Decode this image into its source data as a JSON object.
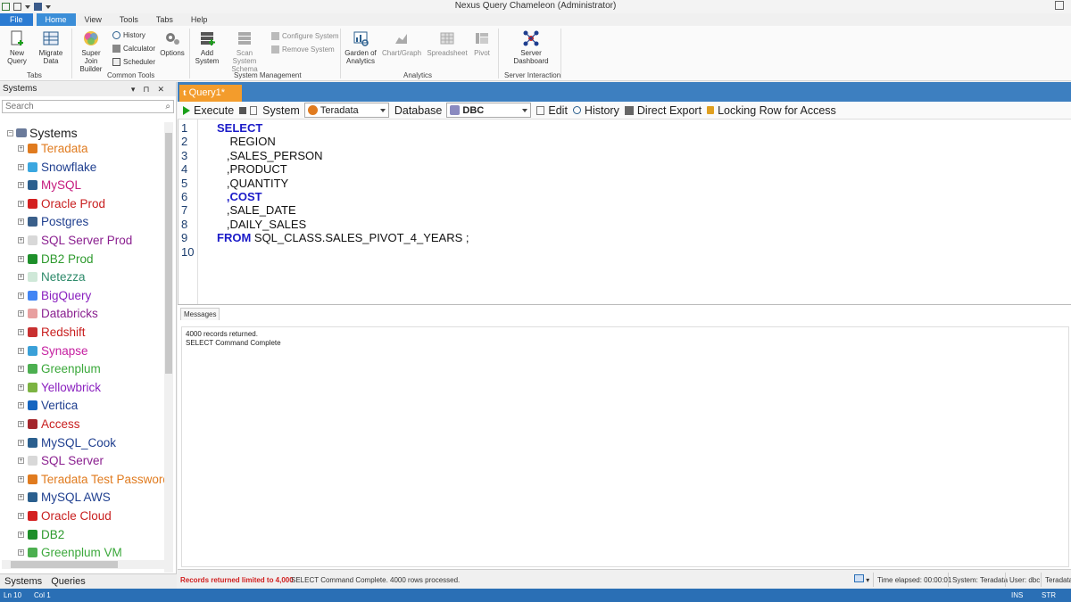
{
  "window": {
    "title": "Nexus Query Chameleon (Administrator)"
  },
  "menu": [
    "File",
    "Home",
    "View",
    "Tools",
    "Tabs",
    "Help"
  ],
  "ribbon": {
    "tabs_group": {
      "label": "Tabs",
      "new_query": "New Query",
      "migrate_data": "Migrate Data"
    },
    "common_tools": {
      "label": "Common Tools",
      "super_join": "Super Join Builder",
      "history": "History",
      "calculator": "Calculator",
      "scheduler": "Scheduler",
      "options": "Options"
    },
    "system_mgmt": {
      "label": "System Management",
      "add_system": "Add System",
      "scan_system": "Scan System Schema",
      "configure_system": "Configure System",
      "remove_system": "Remove System"
    },
    "analytics": {
      "label": "Analytics",
      "garden": "Garden of Analytics",
      "chart_graph": "Chart/Graph",
      "spreadsheet": "Spreadsheet",
      "pivot": "Pivot"
    },
    "server": {
      "label": "Server Interaction",
      "dashboard": "Server Dashboard"
    }
  },
  "systems_panel": {
    "title": "Systems",
    "search_placeholder": "Search",
    "root": "Systems",
    "items": [
      {
        "label": "Teradata",
        "color": "#e07b1f",
        "icon": "#e07b1f"
      },
      {
        "label": "Snowflake",
        "color": "#1f3f8f",
        "icon": "#3ba7e0"
      },
      {
        "label": "MySQL",
        "color": "#c5197d",
        "icon": "#2b5f8e"
      },
      {
        "label": "Oracle Prod",
        "color": "#c81e1e",
        "icon": "#d42020"
      },
      {
        "label": "Postgres",
        "color": "#1f3f8f",
        "icon": "#3a5f8a"
      },
      {
        "label": "SQL Server Prod",
        "color": "#8a1f8f",
        "icon": "#d8d8d8"
      },
      {
        "label": "DB2 Prod",
        "color": "#2d9a2d",
        "icon": "#1e8f2a"
      },
      {
        "label": "Netezza",
        "color": "#2d8a6a",
        "icon": "#cfe8d8"
      },
      {
        "label": "BigQuery",
        "color": "#8a1fbf",
        "icon": "#4285f4"
      },
      {
        "label": "Databricks",
        "color": "#8a1f8f",
        "icon": "#e8a0a0"
      },
      {
        "label": "Redshift",
        "color": "#c81e1e",
        "icon": "#c83030"
      },
      {
        "label": "Synapse",
        "color": "#c51fa0",
        "icon": "#3aa0d8"
      },
      {
        "label": "Greenplum",
        "color": "#3aa83a",
        "icon": "#4caf50"
      },
      {
        "label": "Yellowbrick",
        "color": "#8a1fbf",
        "icon": "#7cb342"
      },
      {
        "label": "Vertica",
        "color": "#1f3f8f",
        "icon": "#1565c0"
      },
      {
        "label": "Access",
        "color": "#c81e1e",
        "icon": "#a4262c"
      },
      {
        "label": "MySQL_Cook",
        "color": "#1f3f8f",
        "icon": "#2b5f8e"
      },
      {
        "label": "SQL Server",
        "color": "#8a1f8f",
        "icon": "#d8d8d8"
      },
      {
        "label": "Teradata Test Password",
        "color": "#e07b1f",
        "icon": "#e07b1f"
      },
      {
        "label": "MySQL AWS",
        "color": "#1f3f8f",
        "icon": "#2b5f8e"
      },
      {
        "label": "Oracle Cloud",
        "color": "#c81e1e",
        "icon": "#d42020"
      },
      {
        "label": "DB2",
        "color": "#2d9a2d",
        "icon": "#1e8f2a"
      },
      {
        "label": "Greenplum VM",
        "color": "#3aa83a",
        "icon": "#4caf50"
      }
    ],
    "tabs": [
      "Systems",
      "Queries"
    ]
  },
  "query_tab": {
    "label": "Query1*"
  },
  "toolbar": {
    "execute": "Execute",
    "system_label": "System",
    "system_value": "Teradata",
    "database_label": "Database",
    "database_value": "DBC",
    "edit": "Edit",
    "history": "History",
    "direct_export": "Direct Export",
    "locking": "Locking Row for Access"
  },
  "editor": {
    "line_numbers": [
      "1",
      "2",
      "3",
      "4",
      "5",
      "6",
      "7",
      "8",
      "9",
      "10"
    ],
    "lines": [
      {
        "indent": "",
        "kw": "SELECT",
        "text": ""
      },
      {
        "indent": "    ",
        "kw": "",
        "text": "REGION"
      },
      {
        "indent": "   ",
        "kw": "",
        "text": ",SALES_PERSON"
      },
      {
        "indent": "   ",
        "kw": "",
        "text": ",PRODUCT"
      },
      {
        "indent": "   ",
        "kw": "",
        "text": ",QUANTITY"
      },
      {
        "indent": "   ",
        "kw": ",COST",
        "text": ""
      },
      {
        "indent": "   ",
        "kw": "",
        "text": ",SALE_DATE"
      },
      {
        "indent": "   ",
        "kw": "",
        "text": ",DAILY_SALES"
      },
      {
        "indent": "",
        "kw": "FROM",
        "text": " SQL_CLASS.SALES_PIVOT_4_YEARS ;"
      },
      {
        "indent": "",
        "kw": "",
        "text": ""
      }
    ]
  },
  "messages": {
    "tab": "Messages",
    "lines": [
      "4000 records returned.",
      "SELECT Command Complete"
    ]
  },
  "status": {
    "limit": "Records returned limited to 4,000",
    "complete": "SELECT Command Complete.  4000 rows processed.",
    "elapsed": "Time elapsed: 00:00:01",
    "system": "System: Teradata",
    "user": "User: dbc",
    "system_short": "Teradata"
  },
  "bottom": {
    "line": "Ln 10",
    "col": "Col 1",
    "ins": "INS",
    "str": "STR"
  }
}
